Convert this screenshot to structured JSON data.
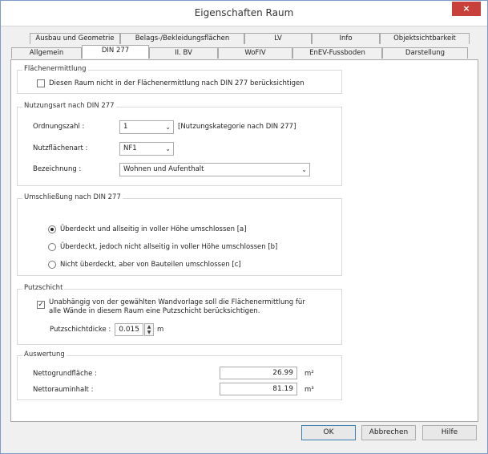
{
  "window": {
    "title": "Eigenschaften Raum",
    "close_glyph": "×"
  },
  "tabs_back": [
    "Ausbau und Geometrie",
    "Belags-/Bekleidungsflächen",
    "LV",
    "Info",
    "Objektsichtbarkeit"
  ],
  "tabs_front": [
    "Allgemein",
    "DIN 277",
    "II. BV",
    "WoFIV",
    "EnEV-Fussboden",
    "Darstellung"
  ],
  "active_tab": "DIN 277",
  "flaechen": {
    "title": "Flächenermittlung",
    "checkbox_label": "Diesen Raum nicht in der Flächenermittlung nach DIN 277 berücksichtigen"
  },
  "nutzung": {
    "title": "Nutzungsart nach DIN 277",
    "ordnung_label": "Ordnungszahl :",
    "ordnung_value": "1",
    "ordnung_note": "[Nutzungskategorie nach DIN 277]",
    "nutzflaeche_label": "Nutzflächenart :",
    "nutzflaeche_value": "NF1",
    "bezeichnung_label": "Bezeichnung :",
    "bezeichnung_value": "Wohnen und Aufenthalt"
  },
  "umschliessung": {
    "title": "Umschließung nach DIN 277",
    "options": [
      "Überdeckt und allseitig in voller Höhe umschlossen [a]",
      "Überdeckt, jedoch nicht allseitig in voller Höhe umschlossen [b]",
      "Nicht überdeckt, aber von Bauteilen umschlossen [c]"
    ]
  },
  "putz": {
    "title": "Putzschicht",
    "checkbox_line1": "Unabhängig von der gewählten Wandvorlage soll die Flächenermittlung für",
    "checkbox_line2": "alle Wände in diesem Raum eine Putzschicht berücksichtigen.",
    "dicke_label": "Putzschichtdicke :",
    "dicke_value": "0.015",
    "unit": "m"
  },
  "auswertung": {
    "title": "Auswertung",
    "netto_grund_label": "Nettogrundfläche :",
    "netto_grund_value": "26.99",
    "netto_grund_unit": "m²",
    "netto_raum_label": "Nettorauminhalt :",
    "netto_raum_value": "81.19",
    "netto_raum_unit": "m³"
  },
  "buttons": {
    "ok": "OK",
    "cancel": "Abbrechen",
    "help": "Hilfe"
  }
}
